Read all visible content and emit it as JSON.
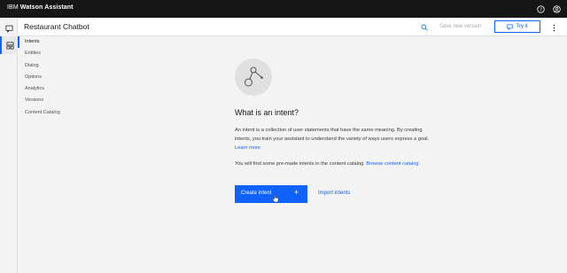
{
  "topbar": {
    "brand_ibm": "IBM",
    "brand_name": "Watson Assistant",
    "icons": [
      "help-icon",
      "user-icon"
    ]
  },
  "rail": {
    "icons": [
      "chat-icon",
      "skills-icon"
    ]
  },
  "header": {
    "title": "Restaurant Chatbot",
    "save_version": "Save new version",
    "try_it": "Try it"
  },
  "sidenav": {
    "items": [
      {
        "label": "Intents"
      },
      {
        "label": "Entities"
      },
      {
        "label": "Dialog"
      },
      {
        "label": "Options"
      },
      {
        "label": "Analytics"
      },
      {
        "label": "Versions"
      },
      {
        "label": "Content Catalog"
      }
    ]
  },
  "empty_state": {
    "heading": "What is an intent?",
    "description": "An intent is a collection of user statements that have the same meaning. By creating intents, you train your assistant to understand the variety of ways users express a goal.",
    "learn_more": "Learn more",
    "catalog_text": "You will find some pre-made intents in the content catalog.",
    "browse_link": "Browse content catalog",
    "create_button": "Create intent",
    "create_plus": "+",
    "import_link": "Import intents"
  },
  "colors": {
    "accent": "#0f62fe",
    "topbar": "#161616",
    "background": "#f3f3f3"
  }
}
